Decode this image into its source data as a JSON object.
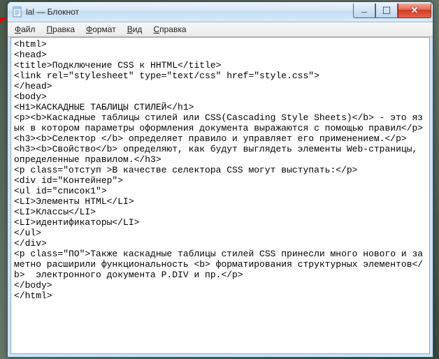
{
  "window": {
    "title": "lal — Блокнот"
  },
  "menu": {
    "file": "Файл",
    "edit": "Правка",
    "format": "Формат",
    "view": "Вид",
    "help": "Справка"
  },
  "editor": {
    "content": "<html>\n<head>\n<title>Подключение CSS к HHTML</title>\n<link rel=\"stylesheet\" type=\"text/css\" href=\"style.css\">\n</head>\n<body>\n<H1>КАСКАДНЫЕ ТАБЛИЦЫ СТИЛЕЙ</h1>\n<p><b>Каскадные таблицы стилей или CSS(Cascading Style Sheets)</b> - это язык в котором параметры оформления документа выражаются с помощью правил</p>\n<h3><b>Селектор </b> определяет правило и управляет его применением.</p>\n<h3><b>Свойство</b> определяют, как будут выглядеть элементы Web-страницы, определенные правилом.</h3>\n<p class=\"отступ >В качестве селектора CSS могут выступать:</p>\n<div id=\"Контейнер\">\n<ul id=\"список1\">\n<LI>Элементы HTML</LI>\n<LI>Классы</LI>\n<LI>идентификаторы</LI>\n</ul>\n</div>\n<p class=\"ПО\">Также каскадные таблицы стилей CSS принесли много нового и заметно расширили функциональность <b> форматирования структурных элементов</b>  электронного документа P.DIV и пр.</p>\n</body>\n</html>"
  }
}
